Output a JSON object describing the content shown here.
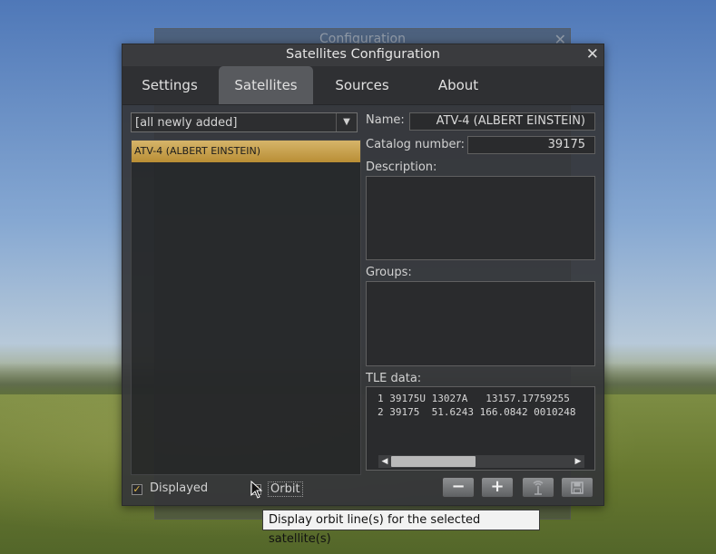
{
  "background_window": {
    "title": "Configuration"
  },
  "dialog": {
    "title": "Satellites Configuration",
    "tabs": [
      {
        "label": "Settings",
        "active": false
      },
      {
        "label": "Satellites",
        "active": true
      },
      {
        "label": "Sources",
        "active": false
      },
      {
        "label": "About",
        "active": false
      }
    ]
  },
  "filter": {
    "selected": "[all newly added]"
  },
  "satellite_list": {
    "items": [
      "ATV-4 (ALBERT EINSTEIN)"
    ],
    "selected_index": 0
  },
  "details": {
    "name_label": "Name:",
    "name_value": "ATV-4 (ALBERT EINSTEIN)",
    "catalog_label": "Catalog number:",
    "catalog_value": "39175",
    "description_label": "Description:",
    "groups_label": "Groups:",
    "tle_label": "TLE data:",
    "tle_lines": [
      "1 39175U 13027A   13157.17759255",
      "2 39175  51.6243 166.0842 0010248"
    ]
  },
  "bottom": {
    "displayed_label": "Displayed",
    "displayed_checked": true,
    "orbit_label": "Orbit",
    "orbit_checked": true
  },
  "buttons": {
    "remove_symbol": "−",
    "add_symbol": "+"
  },
  "tooltip": {
    "text": "Display orbit line(s) for the selected satellite(s)"
  },
  "colors": {
    "accent": "#c9a24c",
    "panel": "#343538"
  }
}
